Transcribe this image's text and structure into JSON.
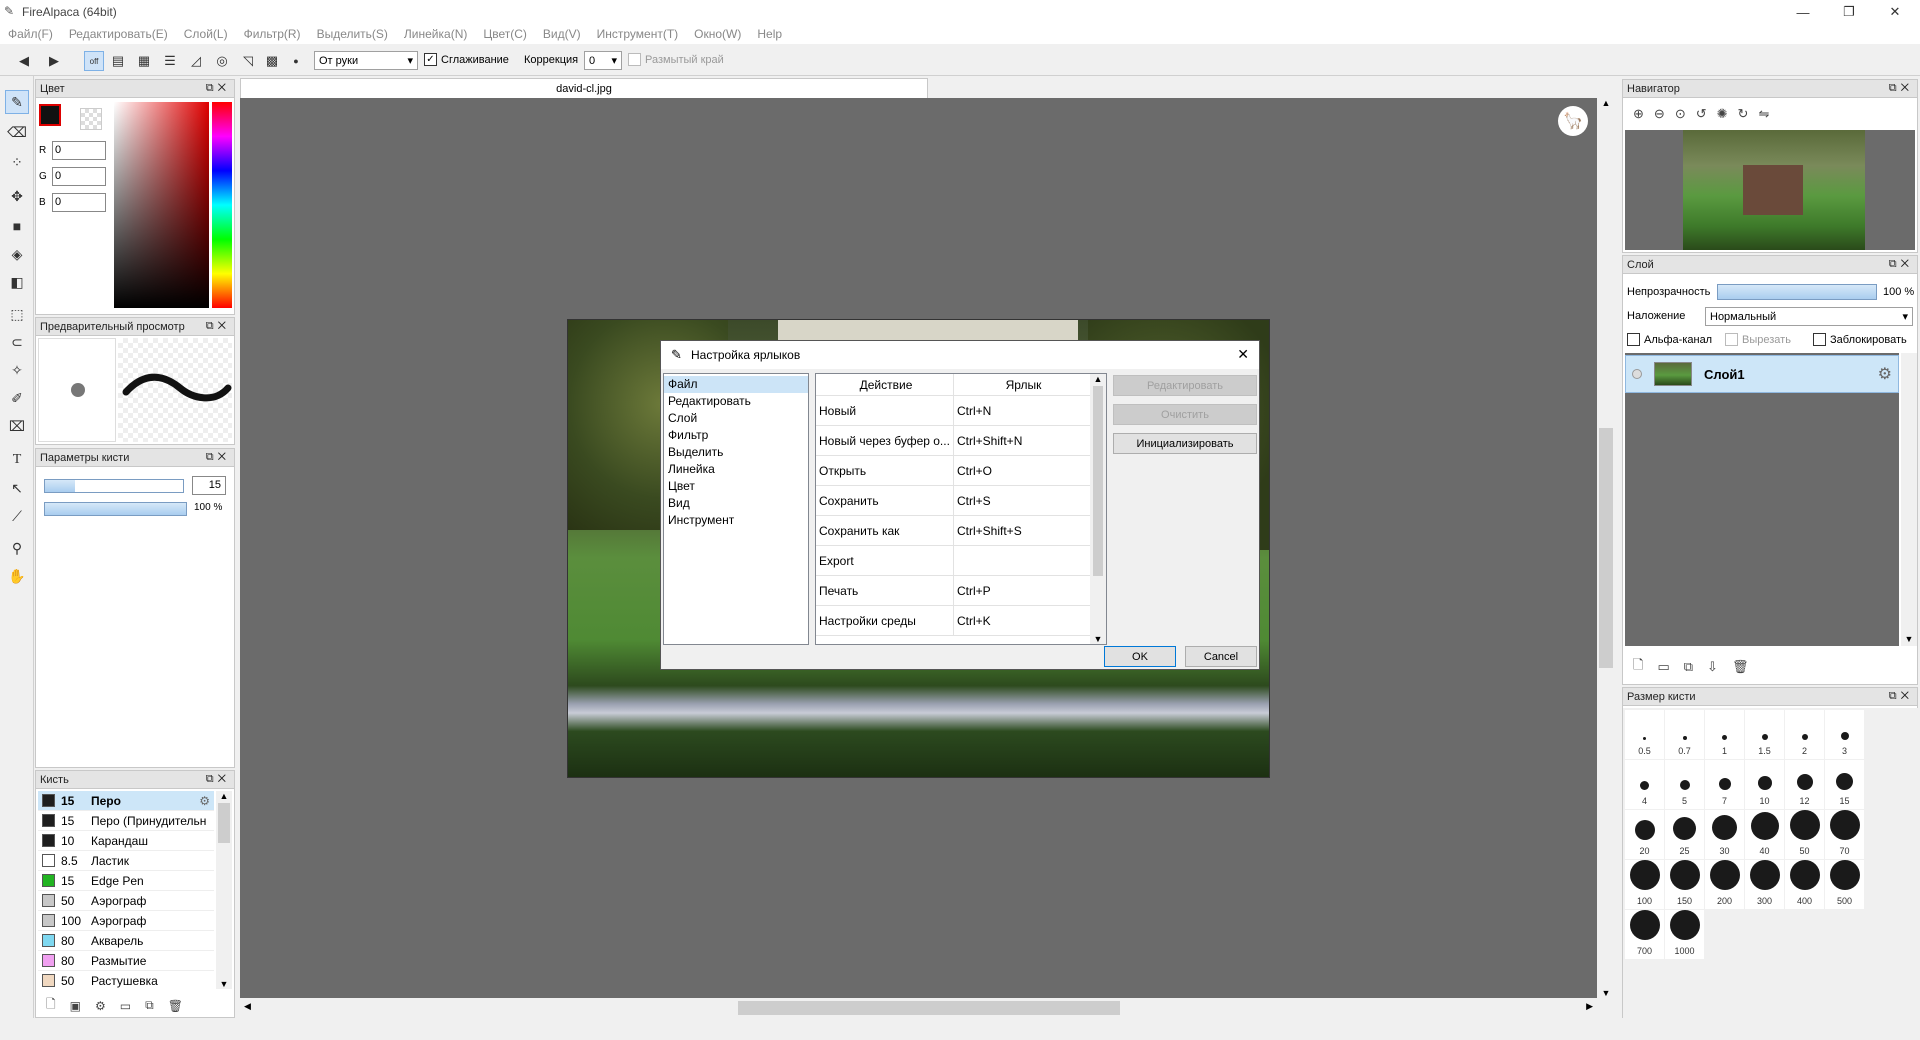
{
  "window": {
    "title": "FireAlpaca (64bit)"
  },
  "menu": [
    "Файл(F)",
    "Редактировать(E)",
    "Слой(L)",
    "Фильтр(R)",
    "Выделить(S)",
    "Линейка(N)",
    "Цвет(C)",
    "Вид(V)",
    "Инструмент(T)",
    "Окно(W)",
    "Help"
  ],
  "toolbar": {
    "mode": "От руки",
    "smooth": "Сглаживание",
    "correction_label": "Коррекция",
    "correction": "0",
    "blur_edge": "Размытый край"
  },
  "panels": {
    "color": "Цвет",
    "preview": "Предварительный просмотр",
    "brush_params": "Параметры кисти",
    "brush": "Кисть",
    "navigator": "Навигатор",
    "layer": "Слой",
    "brush_size": "Размер кисти"
  },
  "color": {
    "r": "0",
    "g": "0",
    "b": "0",
    "r_label": "R",
    "g_label": "G",
    "b_label": "B"
  },
  "brush_params": {
    "size": "15",
    "opacity": "100 %",
    "size_fraction": 0.22,
    "opacity_fraction": 1.0
  },
  "brushes": [
    {
      "size": "15",
      "name": "Перо",
      "color": "#1e1e1e",
      "selected": true
    },
    {
      "size": "15",
      "name": "Перо (Принудительн",
      "color": "#1e1e1e"
    },
    {
      "size": "10",
      "name": "Карандаш",
      "color": "#1e1e1e"
    },
    {
      "size": "8.5",
      "name": "Ластик",
      "color": "#ffffff"
    },
    {
      "size": "15",
      "name": "Edge Pen",
      "color": "#22b422"
    },
    {
      "size": "50",
      "name": "Аэрограф",
      "color": "#c8c8c8"
    },
    {
      "size": "100",
      "name": "Аэрограф",
      "color": "#c8c8c8"
    },
    {
      "size": "80",
      "name": "Акварель",
      "color": "#7fd8f0"
    },
    {
      "size": "80",
      "name": "Размытие",
      "color": "#f0a0f0"
    },
    {
      "size": "50",
      "name": "Растушевка",
      "color": "#f0d8c0"
    }
  ],
  "document": {
    "tab": "david-cl.jpg"
  },
  "dialog": {
    "title": "Настройка ярлыков",
    "categories": [
      "Файл",
      "Редактировать",
      "Слой",
      "Фильтр",
      "Выделить",
      "Линейка",
      "Цвет",
      "Вид",
      "Инструмент"
    ],
    "col_action": "Действие",
    "col_shortcut": "Ярлык",
    "rows": [
      {
        "action": "Новый",
        "shortcut": "Ctrl+N"
      },
      {
        "action": "Новый через буфер о...",
        "shortcut": "Ctrl+Shift+N"
      },
      {
        "action": "Открыть",
        "shortcut": "Ctrl+O"
      },
      {
        "action": "Сохранить",
        "shortcut": "Ctrl+S"
      },
      {
        "action": "Сохранить как",
        "shortcut": "Ctrl+Shift+S"
      },
      {
        "action": "Export",
        "shortcut": ""
      },
      {
        "action": "Печать",
        "shortcut": "Ctrl+P"
      },
      {
        "action": "Настройки среды",
        "shortcut": "Ctrl+K"
      }
    ],
    "btn_edit": "Редактировать",
    "btn_clear": "Очистить",
    "btn_init": "Инициализировать",
    "ok": "OK",
    "cancel": "Cancel"
  },
  "layer": {
    "opacity_label": "Непрозрачность",
    "opacity": "100 %",
    "opacity_fraction": 1.0,
    "blend_label": "Наложение",
    "blend": "Нормальный",
    "alpha": "Альфа-канал",
    "clip": "Вырезать",
    "lock": "Заблокировать",
    "layer_name": "Слой1"
  },
  "brush_sizes": [
    "0.5",
    "0.7",
    "1",
    "1.5",
    "2",
    "3",
    "4",
    "5",
    "7",
    "10",
    "12",
    "15",
    "20",
    "25",
    "30",
    "40",
    "50",
    "70",
    "100",
    "150",
    "200",
    "300",
    "400",
    "500",
    "700",
    "1000"
  ]
}
